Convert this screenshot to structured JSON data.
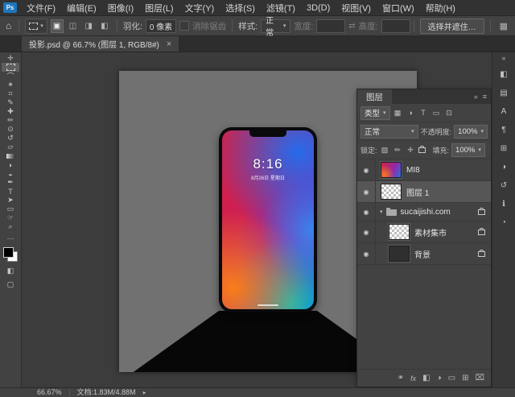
{
  "glyphs": {
    "caret": "▾",
    "eye": "◉",
    "group_expanded": "▾",
    "home": "⌂",
    "swap": "⇄",
    "tab_close": "×",
    "collapse": "«",
    "panel_menu": "≡",
    "panel_collapse": "»",
    "status_chevron": "▸",
    "workspace": "▦"
  },
  "menubar": {
    "logo": "Ps",
    "items": [
      "文件(F)",
      "编辑(E)",
      "图像(I)",
      "图层(L)",
      "文字(Y)",
      "选择(S)",
      "滤镜(T)",
      "3D(D)",
      "视图(V)",
      "窗口(W)",
      "帮助(H)"
    ]
  },
  "options": {
    "mode_icons": [
      {
        "name": "new-selection-icon",
        "glyph": "▣"
      },
      {
        "name": "add-to-selection-icon",
        "glyph": "◫"
      },
      {
        "name": "subtract-from-selection-icon",
        "glyph": "◨"
      },
      {
        "name": "intersect-selection-icon",
        "glyph": "◧"
      }
    ],
    "feather_label": "羽化:",
    "feather_value": "0 像素",
    "antialias_label": "消除锯齿",
    "style_label": "样式:",
    "style_value": "正常",
    "width_label": "宽度:",
    "height_label": "高度:",
    "select_and_mask": "选择并遮住…"
  },
  "tab": {
    "title": "投影.psd @ 66.7% (图层 1, RGB/8#)"
  },
  "tools": [
    {
      "name": "move-tool",
      "glyph": "✛"
    },
    {
      "name": "rectangular-marquee-tool",
      "glyph": ""
    },
    {
      "name": "lasso-tool",
      "glyph": "⌒"
    },
    {
      "name": "magic-wand-tool",
      "glyph": "✶"
    },
    {
      "name": "crop-tool",
      "glyph": "⌗"
    },
    {
      "name": "eyedropper-tool",
      "glyph": "✎"
    },
    {
      "name": "healing-brush-tool",
      "glyph": "✚"
    },
    {
      "name": "brush-tool",
      "glyph": "✏"
    },
    {
      "name": "clone-stamp-tool",
      "glyph": "⊙"
    },
    {
      "name": "history-brush-tool",
      "glyph": "↺"
    },
    {
      "name": "eraser-tool",
      "glyph": "▱"
    },
    {
      "name": "gradient-tool",
      "glyph": ""
    },
    {
      "name": "blur-tool",
      "glyph": "◗"
    },
    {
      "name": "dodge-tool",
      "glyph": "◒"
    },
    {
      "name": "pen-tool",
      "glyph": "✒"
    },
    {
      "name": "type-tool",
      "glyph": "T"
    },
    {
      "name": "path-selection-tool",
      "glyph": "➤"
    },
    {
      "name": "shape-tool",
      "glyph": "▭"
    },
    {
      "name": "hand-tool",
      "glyph": "☞"
    },
    {
      "name": "zoom-tool",
      "glyph": "⌕"
    }
  ],
  "toolbar_extra": {
    "more": "⋯",
    "quick_mask": "◧",
    "screen_mode": "▢"
  },
  "phone": {
    "time": "8:16",
    "date": "8月26日 星期日"
  },
  "layers": {
    "panel_title": "图层",
    "filter_label": "类型",
    "filter_icons": [
      {
        "name": "filter-pixel-layers-icon",
        "glyph": "▦"
      },
      {
        "name": "filter-adjustment-layers-icon",
        "glyph": "◑"
      },
      {
        "name": "filter-type-layers-icon",
        "glyph": "T"
      },
      {
        "name": "filter-shape-layers-icon",
        "glyph": "▭"
      },
      {
        "name": "filter-smart-objects-icon",
        "glyph": "⊡"
      }
    ],
    "blend_mode": "正常",
    "opacity_label": "不透明度:",
    "opacity_value": "100%",
    "lock_label": "锁定:",
    "lock_icons": [
      {
        "name": "lock-transparent-pixels-icon",
        "glyph": "▨"
      },
      {
        "name": "lock-image-pixels-icon",
        "glyph": "✏"
      },
      {
        "name": "lock-position-icon",
        "glyph": "✛"
      }
    ],
    "fill_label": "填充:",
    "fill_value": "100%",
    "rows": [
      {
        "name": "MI8"
      },
      {
        "name": "图层 1"
      },
      {
        "name": "sucaijishi.com"
      },
      {
        "name": "素材集市"
      },
      {
        "name": "背景"
      }
    ],
    "bottom_icons": [
      {
        "name": "link-layers-icon",
        "glyph": "⚭"
      },
      {
        "name": "layer-style-icon",
        "glyph": "fx"
      },
      {
        "name": "add-layer-mask-icon",
        "glyph": "◧"
      },
      {
        "name": "adjustment-layer-icon",
        "glyph": "◑"
      },
      {
        "name": "new-group-icon",
        "glyph": "▭"
      },
      {
        "name": "new-layer-icon",
        "glyph": "⊞"
      },
      {
        "name": "delete-layer-icon",
        "glyph": "⌧"
      }
    ]
  },
  "right_strip": {
    "icons": [
      {
        "name": "color-panel-icon",
        "glyph": "◧"
      },
      {
        "name": "swatches-panel-icon",
        "glyph": "▤"
      },
      {
        "name": "character-panel-icon",
        "glyph": "A"
      },
      {
        "name": "paragraph-panel-icon",
        "glyph": "¶"
      },
      {
        "name": "libraries-panel-icon",
        "glyph": "⊞"
      },
      {
        "name": "adjustments-panel-icon",
        "glyph": "◑"
      },
      {
        "name": "history-panel-icon",
        "glyph": "↺"
      },
      {
        "name": "info-panel-icon",
        "glyph": "ℹ"
      },
      {
        "name": "properties-panel-icon",
        "glyph": "◔"
      }
    ]
  },
  "status": {
    "zoom": "66.67%",
    "doc": "文档:1.83M/4.88M"
  }
}
